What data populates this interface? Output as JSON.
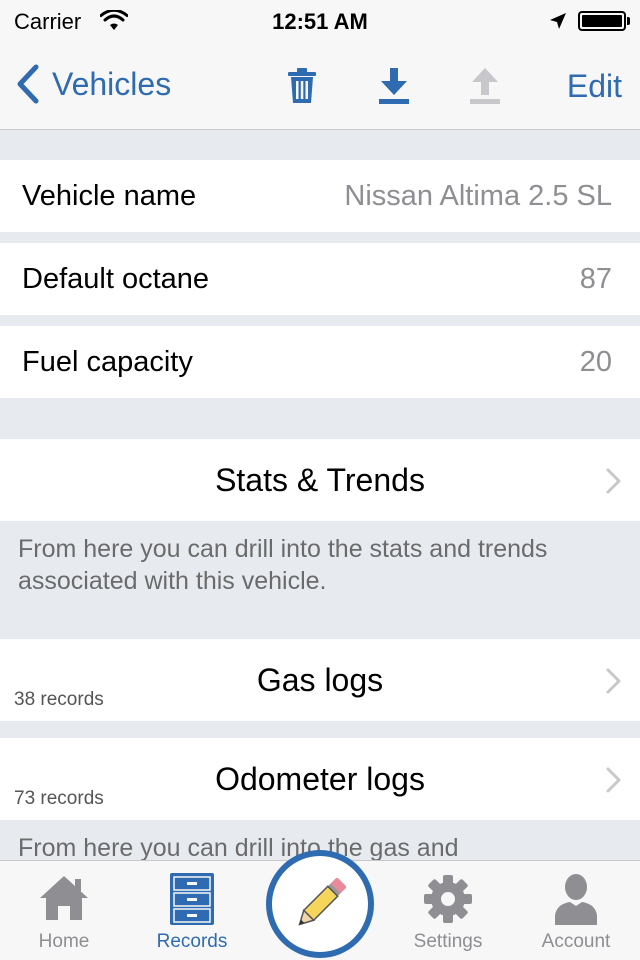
{
  "status_bar": {
    "carrier": "Carrier",
    "time": "12:51 AM",
    "icons": [
      "wifi-icon",
      "location-arrow-icon",
      "battery-icon"
    ]
  },
  "nav": {
    "back_label": "Vehicles",
    "edit_label": "Edit",
    "icons": [
      "trash-icon",
      "download-icon",
      "upload-icon"
    ]
  },
  "vehicle": {
    "name_label": "Vehicle name",
    "name_value": "Nissan Altima 2.5 SL",
    "octane_label": "Default octane",
    "octane_value": "87",
    "capacity_label": "Fuel capacity",
    "capacity_value": "20"
  },
  "stats": {
    "title": "Stats & Trends",
    "note": "From here you can drill into the stats and trends associated with this vehicle."
  },
  "logs": {
    "gas_title": "Gas logs",
    "gas_count": "38 records",
    "odometer_title": "Odometer logs",
    "odometer_count": "73 records",
    "note": "From here you can drill into the gas and"
  },
  "tabs": [
    {
      "label": "Home",
      "icon": "home-icon",
      "active": false
    },
    {
      "label": "Records",
      "icon": "cabinet-icon",
      "active": true
    },
    {
      "label": "Settings",
      "icon": "gear-icon",
      "active": false
    },
    {
      "label": "Account",
      "icon": "person-icon",
      "active": false
    }
  ],
  "colors": {
    "accent": "#2f6bb0",
    "inactive": "#8e8e93",
    "disabled": "#c7c7cc",
    "background": "#e7ebef"
  }
}
